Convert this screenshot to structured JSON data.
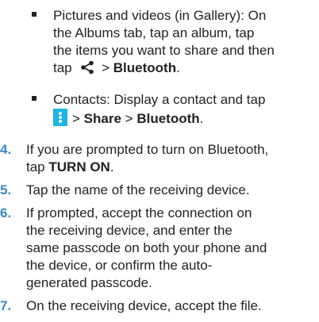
{
  "bullets": [
    {
      "line1": "Pictures and videos (in Gallery): On",
      "line2": "the Albums tab, tap an album, tap",
      "line3": "the items you want to share and then",
      "prefix": "tap",
      "sep": ">",
      "target": "Bluetooth",
      "end": "."
    },
    {
      "line1": "Contacts: Display a contact and tap",
      "sep1": ">",
      "share": "Share",
      "sep2": ">",
      "target": "Bluetooth",
      "end": "."
    }
  ],
  "steps": [
    {
      "num": "4.",
      "line1": "If you are prompted to turn on Bluetooth,",
      "prefix": "tap",
      "bold": "TURN ON",
      "end": "."
    },
    {
      "num": "5.",
      "line1": "Tap the name of the receiving device."
    },
    {
      "num": "6.",
      "line1": "If prompted, accept the connection on",
      "line2": "the receiving device, and enter the",
      "line3": "same passcode on both your phone and",
      "line4": "the device, or confirm the auto-",
      "line5": "generated passcode."
    },
    {
      "num": "7.",
      "line1": "On the receiving device, accept the file."
    }
  ],
  "colors": {
    "step_number": "#3a87c7",
    "menu_icon": "#1db5e4"
  },
  "icons": {
    "share": "share-icon",
    "menu": "more-options-icon"
  }
}
